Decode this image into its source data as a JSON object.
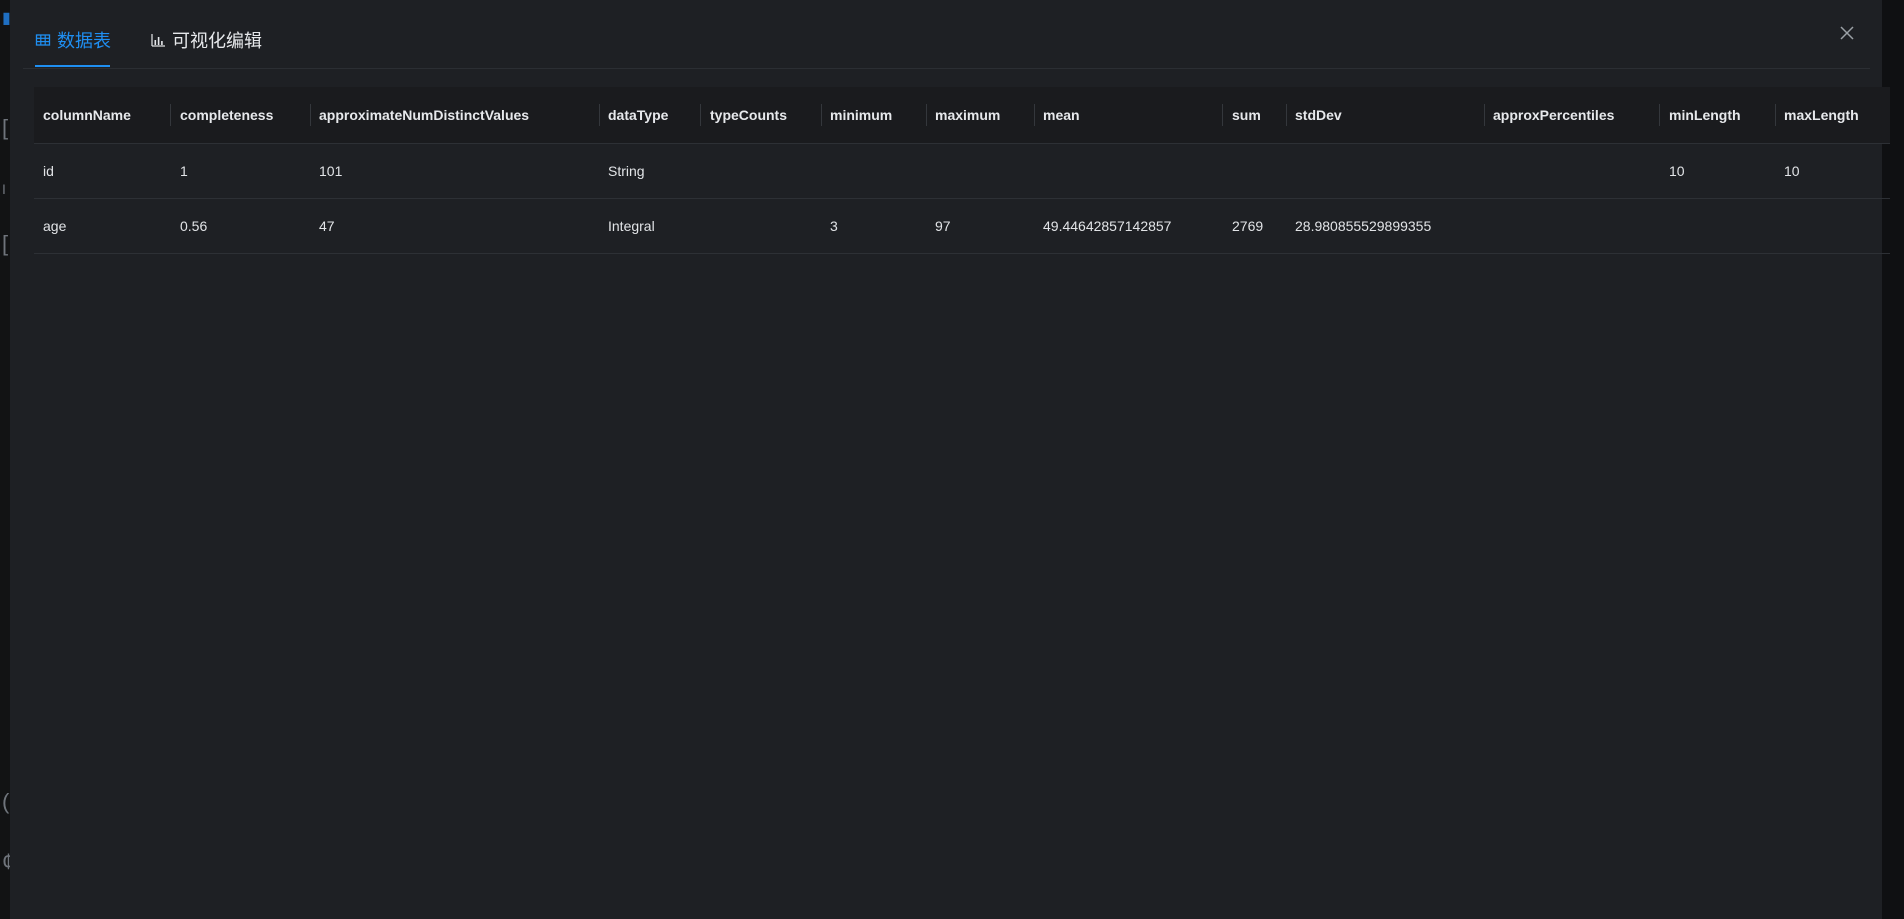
{
  "tabs": [
    {
      "label": "数据表",
      "icon": "table-icon",
      "active": true
    },
    {
      "label": "可视化编辑",
      "icon": "bar-chart-icon",
      "active": false
    }
  ],
  "close_icon": "close-icon",
  "colors": {
    "accent": "#1f8ff2",
    "modal_bg": "#1e2024",
    "header_bg": "#1a1b1e",
    "text": "#e2e4e7"
  },
  "table": {
    "columns": [
      "columnName",
      "completeness",
      "approximateNumDistinctValues",
      "dataType",
      "typeCounts",
      "minimum",
      "maximum",
      "mean",
      "sum",
      "stdDev",
      "approxPercentiles",
      "minLength",
      "maxLength"
    ],
    "rows": [
      [
        "id",
        "1",
        "101",
        "String",
        "",
        "",
        "",
        "",
        "",
        "",
        "",
        "10",
        "10"
      ],
      [
        "age",
        "0.56",
        "47",
        "Integral",
        "",
        "3",
        "97",
        "49.44642857142857",
        "2769",
        "28.980855529899355",
        "",
        "",
        ""
      ]
    ]
  }
}
